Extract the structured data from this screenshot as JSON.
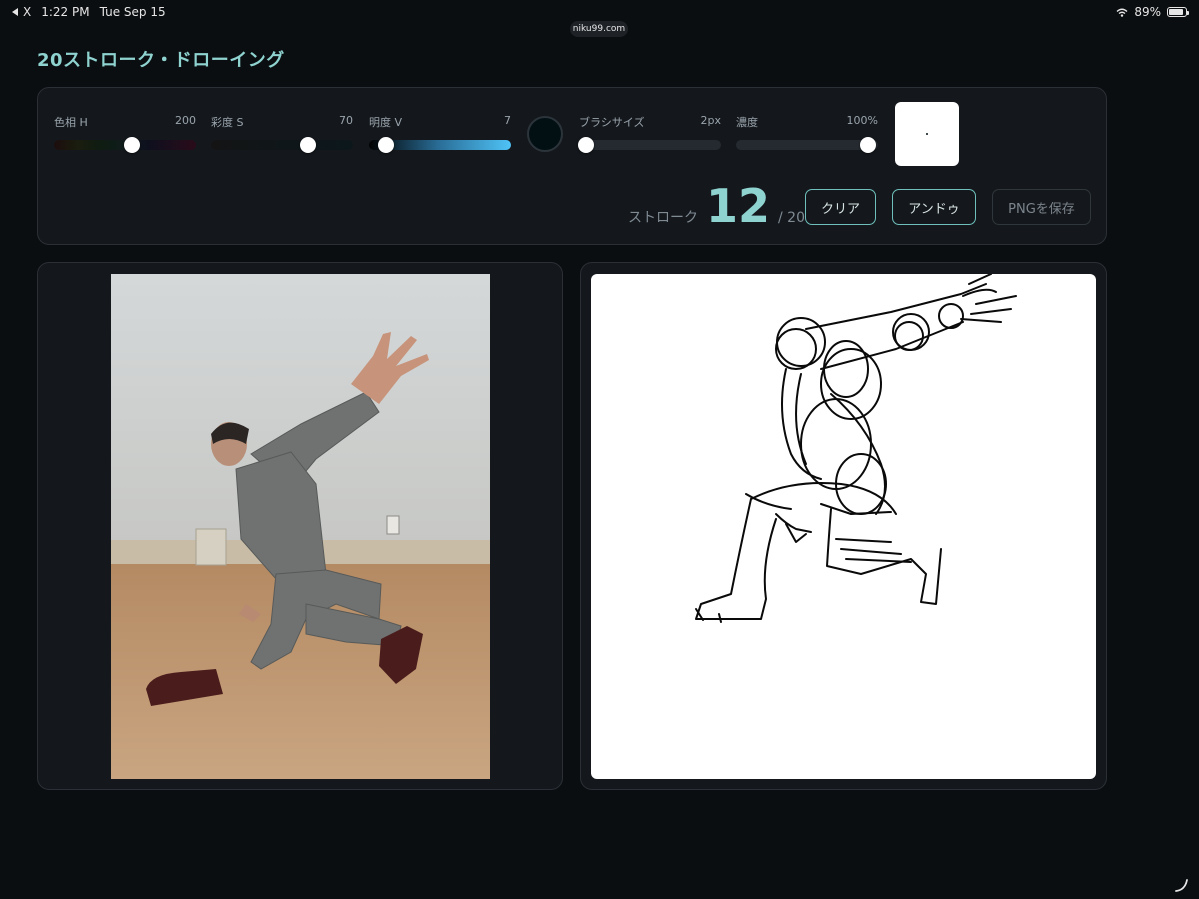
{
  "status_bar": {
    "back_label": "X",
    "time": "1:22 PM",
    "date": "Tue Sep 15",
    "battery": "89%",
    "battery_fraction": 0.89,
    "url": "niku99.com"
  },
  "page": {
    "title": "20ストローク・ドローイング"
  },
  "controls": {
    "hue": {
      "label": "色相 H",
      "value": "200",
      "fraction": 0.55
    },
    "saturation": {
      "label": "彩度 S",
      "value": "70",
      "fraction": 0.68
    },
    "brightness": {
      "label": "明度 V",
      "value": "7",
      "fraction": 0.12
    },
    "brush_size": {
      "label": "ブラシサイズ",
      "value": "2px",
      "fraction": 0.05
    },
    "opacity": {
      "label": "濃度",
      "value": "100%",
      "fraction": 0.93
    },
    "current_color": "#031013"
  },
  "strokes": {
    "label": "ストローク",
    "count": "12",
    "total": "/ 20"
  },
  "buttons": {
    "clear": "クリア",
    "undo": "アンドゥ",
    "save_png": "PNGを保存"
  },
  "colors": {
    "accent": "#8fd3d0",
    "background": "#0b0e11",
    "panel": "#14181c"
  },
  "icons": {
    "back": "back-arrow-icon",
    "wifi": "wifi-icon",
    "battery": "battery-icon",
    "corner": "resize-corner-icon"
  }
}
